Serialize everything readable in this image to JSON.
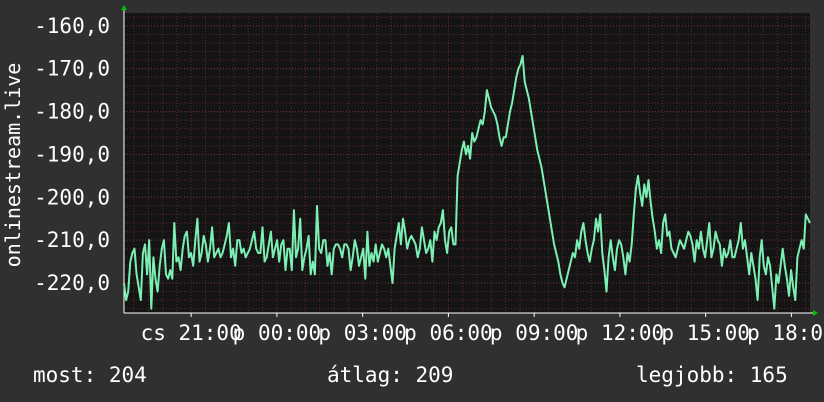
{
  "chart_data": {
    "type": "line",
    "ylabel": "onlinestream.live",
    "y_ticks": [
      -160,
      -170,
      -180,
      -190,
      -200,
      -210,
      -220
    ],
    "y_tick_labels": [
      "-160,0",
      "-170,0",
      "-180,0",
      "-190,0",
      "-200,0",
      "-210,0",
      "-220,0"
    ],
    "ylim": [
      -227,
      -157
    ],
    "xlim": [
      0,
      24
    ],
    "x_ticks": [
      {
        "x": 2.35,
        "label": "cs 21:00"
      },
      {
        "x": 5.35,
        "label": "p 00:00"
      },
      {
        "x": 8.35,
        "label": "p 03:00"
      },
      {
        "x": 11.35,
        "label": "p 06:00"
      },
      {
        "x": 14.35,
        "label": "p 09:00"
      },
      {
        "x": 17.35,
        "label": "p 12:00"
      },
      {
        "x": 20.35,
        "label": "p 15:00"
      },
      {
        "x": 23.35,
        "label": "p 18:00"
      }
    ],
    "grid": true,
    "colors": {
      "background": "#303030",
      "plot_background": "#141414",
      "grid": "#5a2a2a",
      "line": "#7cf0b4",
      "axis": "#ffffff",
      "arrow": "#00c000"
    },
    "series": [
      {
        "values": [
          -220,
          -224,
          -222,
          -215,
          -213,
          -212,
          -218,
          -221,
          -224,
          -213,
          -211,
          -218,
          -210,
          -226,
          -214,
          -219,
          -222,
          -216,
          -212,
          -210,
          -218,
          -219,
          -217,
          -219,
          -206,
          -215,
          -214,
          -217,
          -212,
          -209,
          -208,
          -214,
          -213,
          -216,
          -210,
          -205,
          -215,
          -213,
          -209,
          -211,
          -215,
          -212,
          -207,
          -214,
          -213,
          -212,
          -214,
          -213,
          -211,
          -209,
          -206,
          -214,
          -212,
          -216,
          -210,
          -210,
          -213,
          -212,
          -214,
          -213,
          -212,
          -210,
          -208,
          -212,
          -213,
          -213,
          -207,
          -215,
          -214,
          -211,
          -208,
          -214,
          -212,
          -210,
          -215,
          -211,
          -210,
          -217,
          -212,
          -212,
          -217,
          -203,
          -214,
          -212,
          -205,
          -217,
          -214,
          -212,
          -209,
          -218,
          -215,
          -218,
          -202,
          -212,
          -213,
          -210,
          -210,
          -216,
          -213,
          -218,
          -212,
          -211,
          -211,
          -212,
          -214,
          -211,
          -211,
          -212,
          -217,
          -214,
          -210,
          -212,
          -216,
          -214,
          -212,
          -219,
          -208,
          -216,
          -213,
          -215,
          -211,
          -215,
          -213,
          -211,
          -212,
          -214,
          -212,
          -216,
          -220,
          -212,
          -209,
          -206,
          -211,
          -205,
          -208,
          -212,
          -210,
          -209,
          -210,
          -211,
          -214,
          -212,
          -207,
          -210,
          -213,
          -212,
          -210,
          -215,
          -208,
          -210,
          -207,
          -206,
          -203,
          -210,
          -213,
          -208,
          -207,
          -211,
          -211,
          -195,
          -192,
          -189,
          -187,
          -190,
          -188,
          -191,
          -185,
          -187,
          -186,
          -184,
          -182,
          -183,
          -180,
          -175,
          -177,
          -179,
          -180,
          -181,
          -183,
          -186,
          -188,
          -186,
          -186,
          -183,
          -180,
          -178,
          -175,
          -172,
          -170,
          -169,
          -167,
          -173,
          -175,
          -177,
          -180,
          -183,
          -186,
          -189,
          -191,
          -193,
          -196,
          -199,
          -202,
          -205,
          -208,
          -211,
          -213,
          -215,
          -218,
          -220,
          -221,
          -219,
          -217,
          -215,
          -213,
          -214,
          -210,
          -212,
          -208,
          -206,
          -210,
          -213,
          -215,
          -212,
          -210,
          -205,
          -208,
          -204,
          -213,
          -217,
          -222,
          -214,
          -210,
          -214,
          -217,
          -212,
          -210,
          -211,
          -214,
          -218,
          -213,
          -215,
          -211,
          -204,
          -198,
          -195,
          -199,
          -202,
          -197,
          -200,
          -196,
          -201,
          -205,
          -208,
          -212,
          -210,
          -213,
          -206,
          -204,
          -209,
          -208,
          -212,
          -213,
          -214,
          -212,
          -210,
          -211,
          -212,
          -210,
          -208,
          -209,
          -211,
          -215,
          -210,
          -212,
          -208,
          -212,
          -214,
          -210,
          -206,
          -214,
          -212,
          -208,
          -210,
          -211,
          -216,
          -212,
          -214,
          -213,
          -210,
          -214,
          -214,
          -212,
          -210,
          -206,
          -212,
          -210,
          -214,
          -218,
          -213,
          -216,
          -219,
          -224,
          -214,
          -210,
          -216,
          -218,
          -214,
          -216,
          -221,
          -226,
          -218,
          -220,
          -216,
          -212,
          -216,
          -219,
          -223,
          -217,
          -221,
          -224,
          -214,
          -212,
          -210,
          -212,
          -204,
          -205,
          -206
        ]
      }
    ]
  },
  "footer": {
    "now": "most: 204",
    "avg": "átlag: 209",
    "best": "legjobb: 165"
  }
}
